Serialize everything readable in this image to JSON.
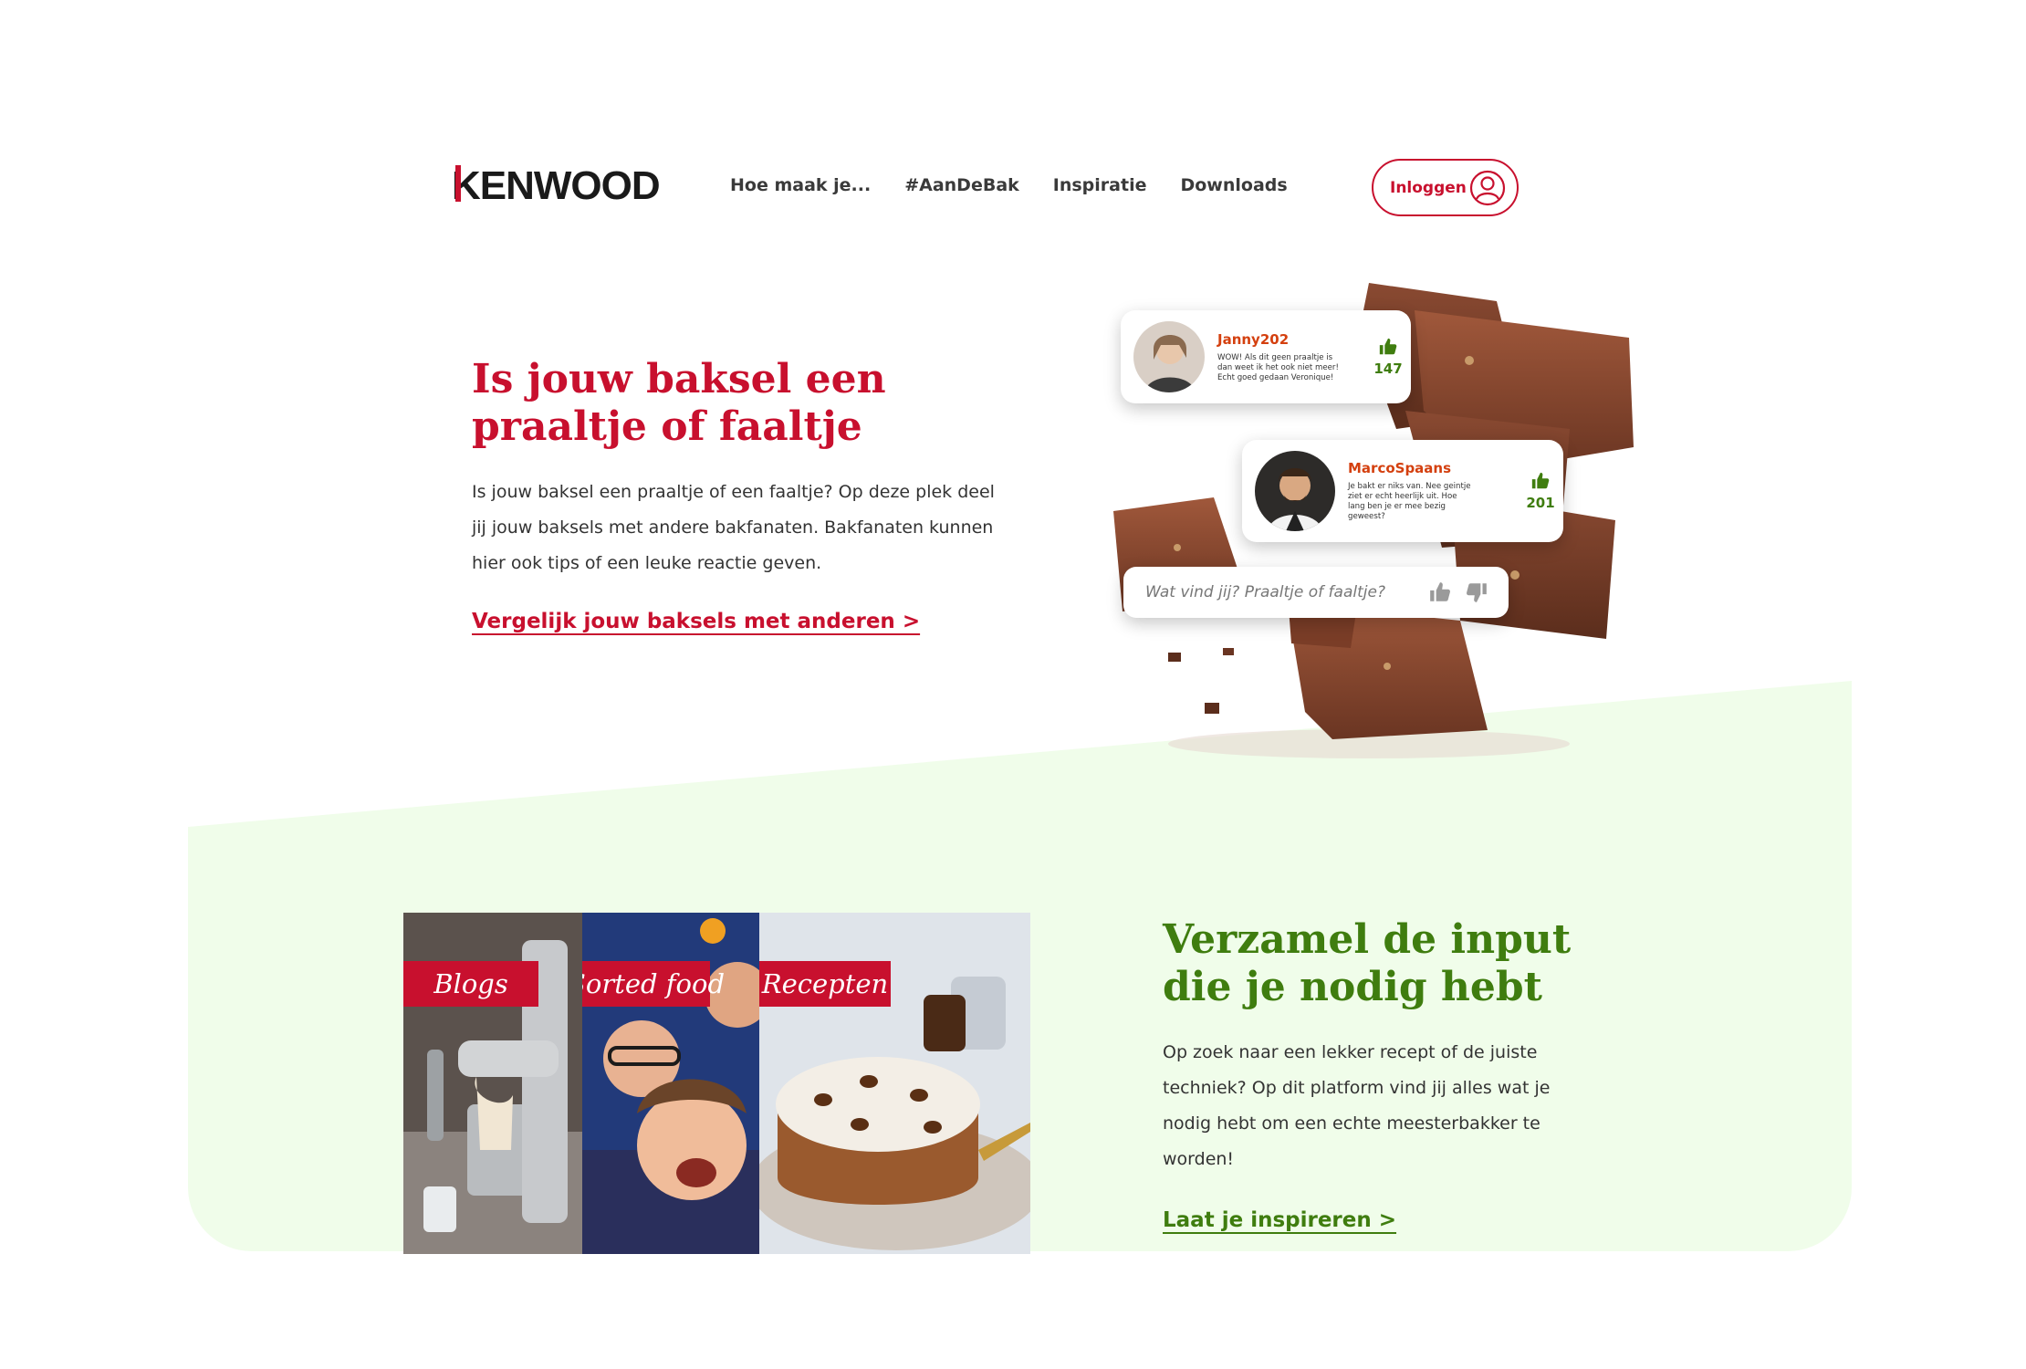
{
  "brand": {
    "logo_text": "KENWOOD"
  },
  "nav": {
    "items": [
      {
        "label": "Hoe maak je..."
      },
      {
        "label": "#AanDeBak"
      },
      {
        "label": "Inspiratie"
      },
      {
        "label": "Downloads"
      }
    ]
  },
  "header": {
    "login_label": "Inloggen"
  },
  "hero": {
    "title": "Is jouw baksel een praaltje of faaltje",
    "text": "Is jouw baksel een praaltje of een faaltje? Op deze plek deel jij jouw baksels met andere bakfanaten. Bakfanaten kunnen hier ook tips of een leuke reactie geven.",
    "link": "Vergelijk jouw baksels met anderen >"
  },
  "comments": [
    {
      "user": "Janny202",
      "message": "WOW! Als dit geen praaltje is dan weet ik het ook niet meer! Echt goed gedaan Veronique!",
      "likes": "147"
    },
    {
      "user": "MarcoSpaans",
      "message": "Je bakt er niks van. Nee geintje ziet er echt heerlijk uit. Hoe lang ben je er mee bezig geweest?",
      "likes": "201"
    }
  ],
  "rating_box": {
    "placeholder": "Wat vind jij? Praaltje of faaltje?"
  },
  "section2": {
    "title": "Verzamel de input die je nodig hebt",
    "text": "Op zoek naar een lekker recept of de juiste techniek? Op dit platform vind jij alles wat je nodig hebt om een echte meesterbakker te worden!",
    "link": "Laat je inspireren >"
  },
  "tiles": [
    {
      "label": "Blogs"
    },
    {
      "label": "Sorted food"
    },
    {
      "label": "Recepten"
    }
  ],
  "colors": {
    "brand_red": "#c8102e",
    "accent_green": "#3f7d0f",
    "band_green": "#f0fdea",
    "username_orange": "#d4400f"
  }
}
